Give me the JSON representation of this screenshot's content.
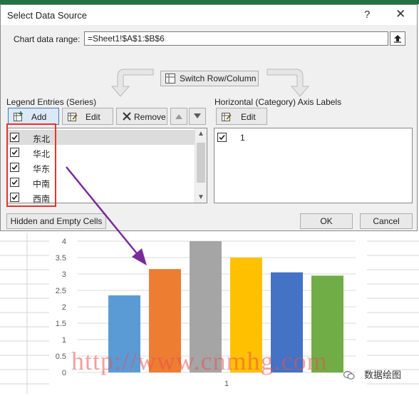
{
  "dialog": {
    "title": "Select Data Source",
    "help_label": "?",
    "close_label": "✕",
    "range_label": "Chart data range:",
    "range_value": "=Sheet1!$A$1:$B$6",
    "switch_label": "Switch Row/Column",
    "legend_label": "Legend Entries (Series)",
    "axis_label": "Horizontal (Category) Axis Labels",
    "add_label": "Add",
    "edit_label": "Edit",
    "remove_label": "Remove",
    "axis_edit_label": "Edit",
    "series": [
      "东北",
      "华北",
      "华东",
      "中南",
      "西南"
    ],
    "categories": [
      "1"
    ],
    "hidden_cells_label": "Hidden and Empty Cells",
    "ok_label": "OK",
    "cancel_label": "Cancel"
  },
  "chart_data": {
    "type": "bar",
    "categories": [
      "1"
    ],
    "series": [
      {
        "values": [
          2.35
        ]
      },
      {
        "values": [
          3.15
        ]
      },
      {
        "values": [
          4.0
        ]
      },
      {
        "values": [
          3.5
        ]
      },
      {
        "values": [
          3.05
        ]
      },
      {
        "values": [
          2.95
        ]
      }
    ],
    "colors": [
      "#5b9bd5",
      "#ed7d31",
      "#a5a5a5",
      "#ffc000",
      "#4472c4",
      "#70ad47"
    ],
    "yticks": [
      "0",
      "0.5",
      "1",
      "1.5",
      "2",
      "2.5",
      "3",
      "3.5",
      "4"
    ],
    "ylim": [
      0,
      4
    ],
    "x_tick": "1",
    "grid": true
  },
  "watermark": "http://www.cnmhg.com",
  "wechat_label": "数据绘图",
  "accent": "#217346"
}
